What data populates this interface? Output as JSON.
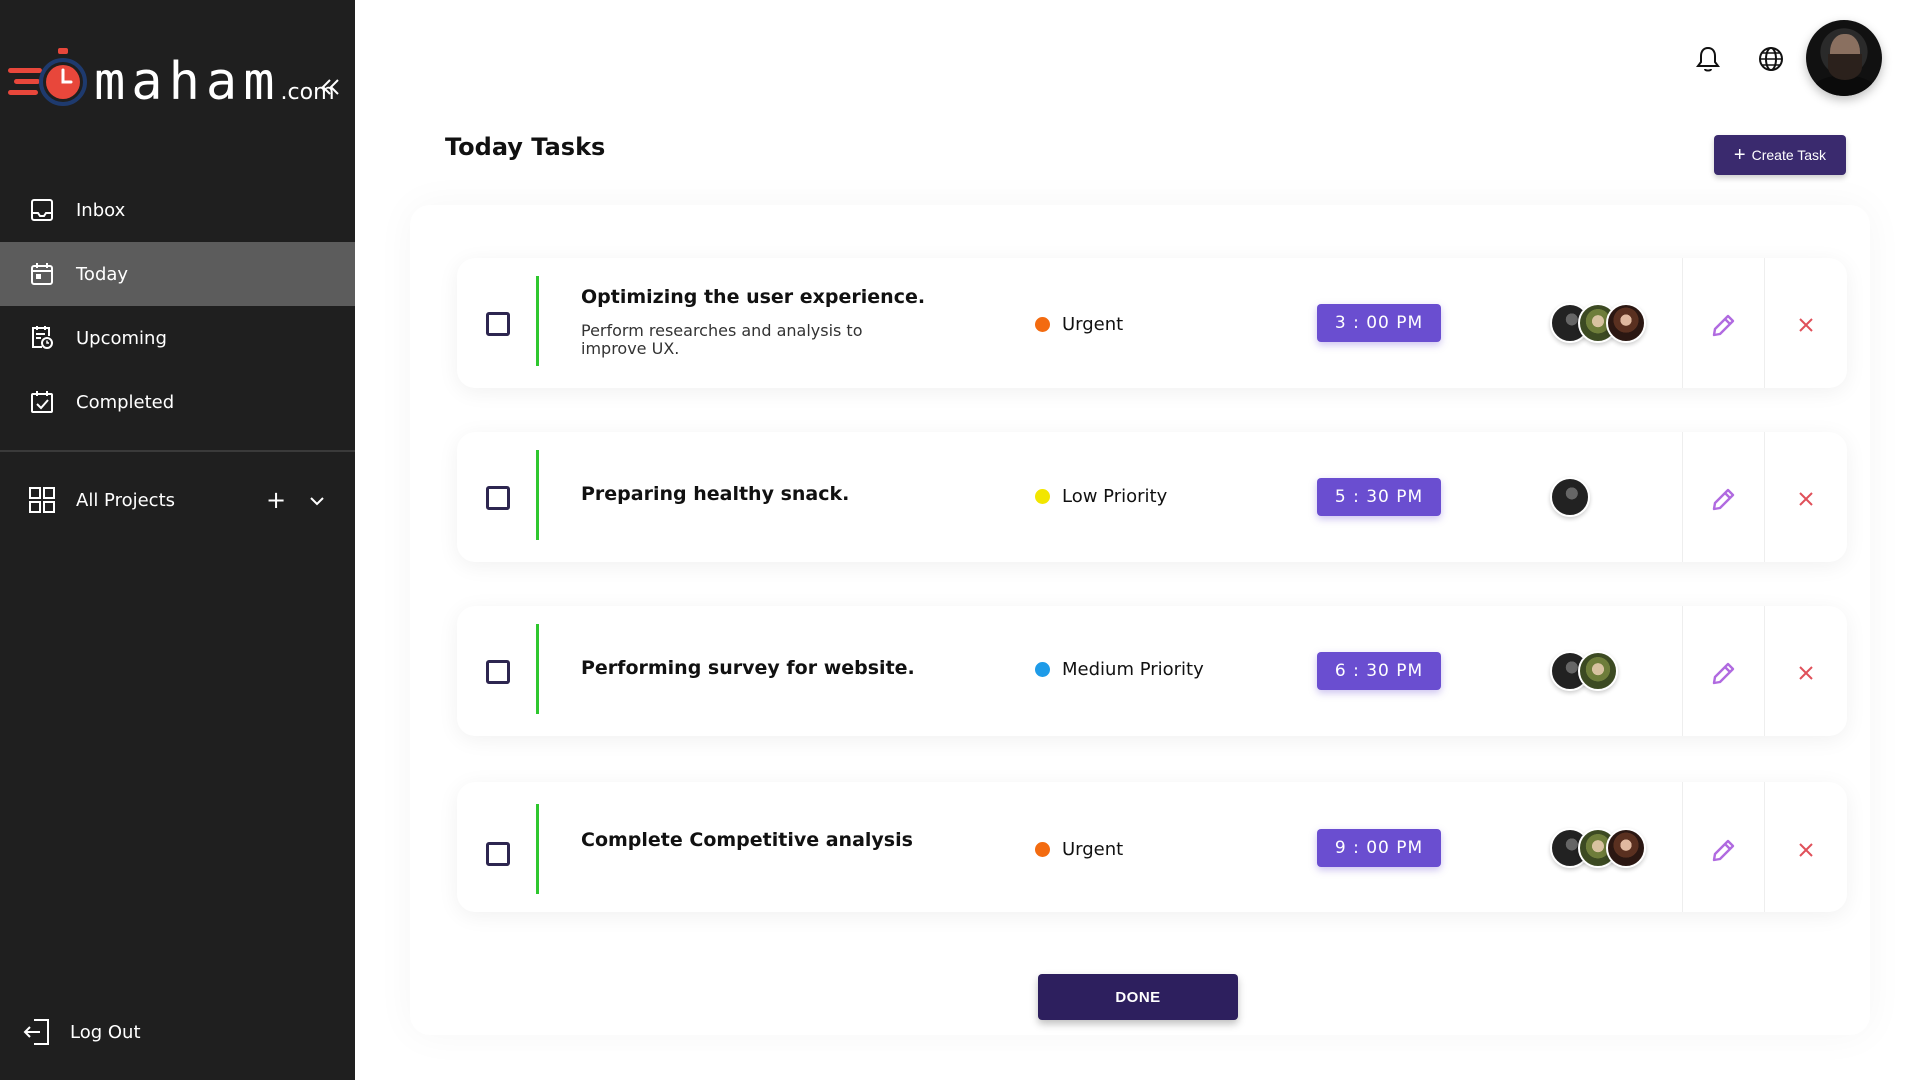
{
  "brand": {
    "name": "maham",
    "suffix": ".com",
    "accent": "#e8473b"
  },
  "sidebar": {
    "items": [
      {
        "label": "Inbox",
        "icon": "inbox-icon"
      },
      {
        "label": "Today",
        "icon": "calendar-today-icon",
        "active": true
      },
      {
        "label": "Upcoming",
        "icon": "calendar-clock-icon"
      },
      {
        "label": "Completed",
        "icon": "calendar-check-icon"
      }
    ],
    "projects_label": "All Projects",
    "logout_label": "Log Out",
    "background": "#1f1f1f",
    "active_background": "#5c5c5c"
  },
  "header": {
    "page_title": "Today Tasks",
    "create_task_label": "Create Task"
  },
  "tasks": [
    {
      "title": "Optimizing the user experience.",
      "description": "Perform researches and analysis to improve UX.",
      "priority": "Urgent",
      "priority_color": "#f36b10",
      "time": "3 : 00 PM",
      "people": 3
    },
    {
      "title": "Preparing healthy snack.",
      "description": "",
      "priority": "Low Priority",
      "priority_color": "#f2e600",
      "time": "5 : 30 PM",
      "people": 1
    },
    {
      "title": "Performing survey for website.",
      "description": "",
      "priority": "Medium Priority",
      "priority_color": "#1e9be8",
      "time": "6 : 30 PM",
      "people": 2
    },
    {
      "title": "Complete Competitive analysis",
      "description": "",
      "priority": "Urgent",
      "priority_color": "#f36b10",
      "time": "9 : 00 PM",
      "people": 3
    }
  ],
  "done_label": "DONE",
  "colors": {
    "primary": "#3a2a6e",
    "time_badge": "#6a4ed0",
    "task_bar": "#2ec72e",
    "edit_icon": "#b06ae0",
    "delete_icon": "#e0505a"
  }
}
